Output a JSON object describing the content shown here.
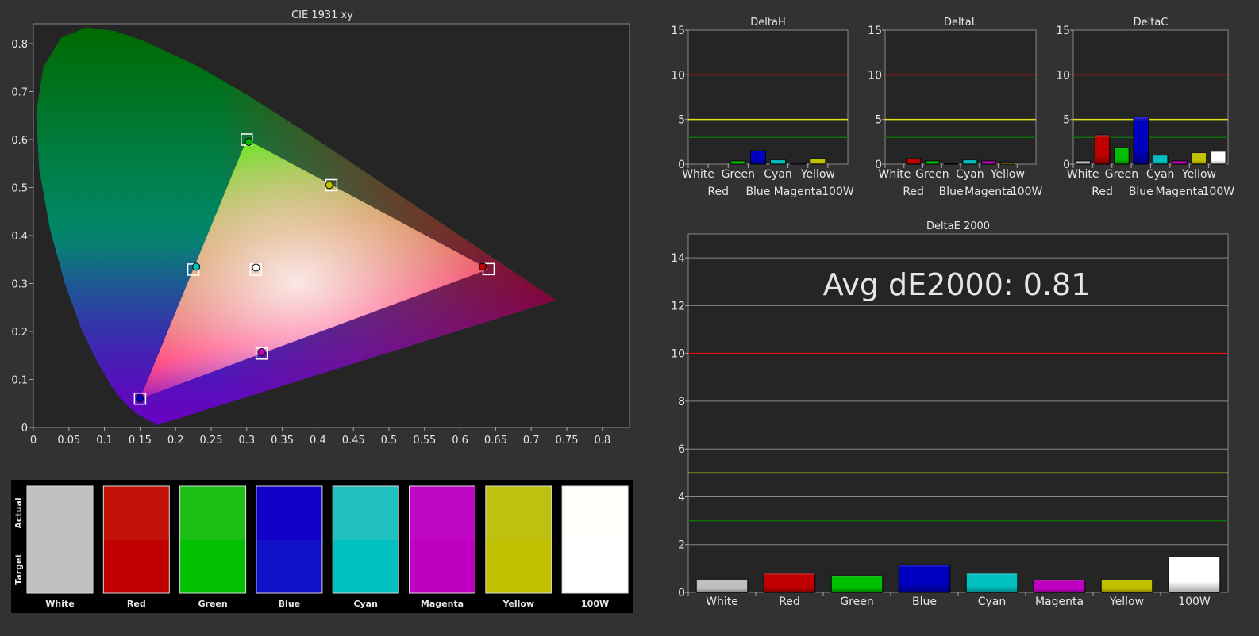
{
  "chart_data": [
    {
      "type": "scatter",
      "title": "CIE 1931 xy",
      "xlim": [
        0,
        0.8
      ],
      "ylim": [
        0,
        0.85
      ],
      "xticks": [
        "0",
        "0.05",
        "0.1",
        "0.15",
        "0.2",
        "0.25",
        "0.3",
        "0.35",
        "0.4",
        "0.45",
        "0.5",
        "0.55",
        "0.6",
        "0.65",
        "0.7",
        "0.75",
        "0.8"
      ],
      "yticks": [
        "0",
        "0.1",
        "0.2",
        "0.3",
        "0.4",
        "0.5",
        "0.6",
        "0.7",
        "0.8"
      ],
      "targets": [
        {
          "name": "Red",
          "x": 0.64,
          "y": 0.33
        },
        {
          "name": "Green",
          "x": 0.3,
          "y": 0.6
        },
        {
          "name": "Blue",
          "x": 0.15,
          "y": 0.06
        },
        {
          "name": "White",
          "x": 0.3127,
          "y": 0.329
        },
        {
          "name": "Cyan",
          "x": 0.225,
          "y": 0.329
        },
        {
          "name": "Magenta",
          "x": 0.321,
          "y": 0.154
        },
        {
          "name": "Yellow",
          "x": 0.419,
          "y": 0.505
        }
      ],
      "actuals": [
        {
          "name": "Red",
          "x": 0.632,
          "y": 0.335,
          "color": "#c00000"
        },
        {
          "name": "Green",
          "x": 0.303,
          "y": 0.595,
          "color": "#00c000"
        },
        {
          "name": "Blue",
          "x": 0.15,
          "y": 0.061,
          "color": "#0000c0"
        },
        {
          "name": "White",
          "x": 0.313,
          "y": 0.333,
          "color": "#ffffff"
        },
        {
          "name": "Cyan",
          "x": 0.229,
          "y": 0.335,
          "color": "#00c0c0"
        },
        {
          "name": "Magenta",
          "x": 0.321,
          "y": 0.157,
          "color": "#c000c0"
        },
        {
          "name": "Yellow",
          "x": 0.416,
          "y": 0.505,
          "color": "#c0c000"
        }
      ]
    },
    {
      "type": "bar",
      "title": "DeltaH",
      "ylim": [
        0,
        15
      ],
      "yticks": [
        "0",
        "5",
        "10",
        "15"
      ],
      "categories": [
        "White",
        "Red",
        "Green",
        "Blue",
        "Cyan",
        "Magenta",
        "Yellow",
        "100W"
      ],
      "values": [
        0,
        0,
        0.36,
        1.55,
        0.48,
        0.1,
        0.65,
        0
      ]
    },
    {
      "type": "bar",
      "title": "DeltaL",
      "ylim": [
        0,
        15
      ],
      "yticks": [
        "0",
        "5",
        "10",
        "15"
      ],
      "categories": [
        "White",
        "Red",
        "Green",
        "Blue",
        "Cyan",
        "Magenta",
        "Yellow",
        "100W"
      ],
      "values": [
        0,
        0.65,
        0.36,
        0.1,
        0.48,
        0.36,
        0.2,
        0
      ]
    },
    {
      "type": "bar",
      "title": "DeltaC",
      "ylim": [
        0,
        15
      ],
      "yticks": [
        "0",
        "5",
        "10",
        "15"
      ],
      "categories": [
        "White",
        "Red",
        "Green",
        "Blue",
        "Cyan",
        "Magenta",
        "Yellow",
        "100W"
      ],
      "values": [
        0.36,
        3.27,
        1.9,
        5.36,
        1.0,
        0.36,
        1.28,
        1.43
      ]
    },
    {
      "type": "bar",
      "title": "DeltaE 2000",
      "annotation": "Avg dE2000: 0.81",
      "ylim": [
        0,
        15
      ],
      "yticks": [
        "0",
        "2",
        "4",
        "6",
        "8",
        "10",
        "12",
        "14"
      ],
      "categories": [
        "White",
        "Red",
        "Green",
        "Blue",
        "Cyan",
        "Magenta",
        "Yellow",
        "100W"
      ],
      "values": [
        0.55,
        0.8,
        0.71,
        1.17,
        0.8,
        0.51,
        0.55,
        1.51
      ]
    }
  ],
  "thresholds": [
    {
      "value": 10,
      "color": "#e01010"
    },
    {
      "value": 5,
      "color": "#e0e020"
    },
    {
      "value": 3,
      "color": "#107010"
    }
  ],
  "bar_colors": [
    "#c0c0c0",
    "#c00000",
    "#00c000",
    "#0000c0",
    "#00c0c0",
    "#c000c0",
    "#c0c000",
    "#ffffff"
  ],
  "swatches": {
    "actual_label": "Actual",
    "target_label": "Target",
    "items": [
      {
        "name": "White",
        "actual": "#c0c0c0",
        "target": "#c0c0c0"
      },
      {
        "name": "Red",
        "actual": "#c21208",
        "target": "#c00000"
      },
      {
        "name": "Green",
        "actual": "#1cc014",
        "target": "#00c000"
      },
      {
        "name": "Blue",
        "actual": "#1200c8",
        "target": "#1010c8"
      },
      {
        "name": "Cyan",
        "actual": "#20c0c0",
        "target": "#00c0c0"
      },
      {
        "name": "Magenta",
        "actual": "#c008c4",
        "target": "#c000c0"
      },
      {
        "name": "Yellow",
        "actual": "#c0c010",
        "target": "#c0c000"
      },
      {
        "name": "100W",
        "actual": "#fffffc",
        "target": "#ffffff"
      }
    ]
  }
}
